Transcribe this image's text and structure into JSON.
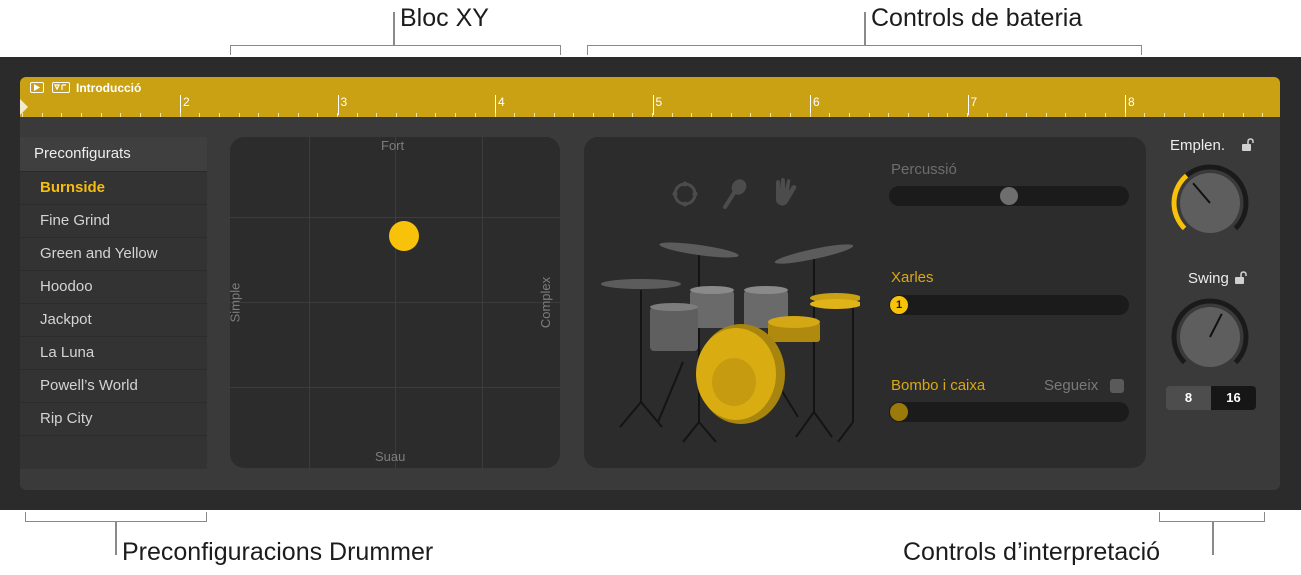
{
  "callouts": {
    "xy_pad": "Bloc XY",
    "drum_controls": "Controls de bateria",
    "presets": "Preconfiguracions Drummer",
    "performance": "Controls d’interpretació"
  },
  "region": {
    "name": "Introducció",
    "bar_numbers": [
      "2",
      "3",
      "4",
      "5",
      "6",
      "7",
      "8"
    ]
  },
  "presets": {
    "header": "Preconfigurats",
    "items": [
      {
        "label": "Burnside",
        "selected": true
      },
      {
        "label": "Fine Grind",
        "selected": false
      },
      {
        "label": "Green and Yellow",
        "selected": false
      },
      {
        "label": "Hoodoo",
        "selected": false
      },
      {
        "label": "Jackpot",
        "selected": false
      },
      {
        "label": "La Luna",
        "selected": false
      },
      {
        "label": "Powell’s World",
        "selected": false
      },
      {
        "label": "Rip City",
        "selected": false
      }
    ]
  },
  "xy_pad": {
    "top": "Fort",
    "bottom": "Suau",
    "left": "Simple",
    "right": "Complex"
  },
  "drum_controls": {
    "percussion_label": "Percussió",
    "percussion_level": 0.5,
    "hihat_label": "Xarles",
    "hihat_value": "1",
    "kick_snare_label": "Bombo i caixa",
    "follow_label": "Segueix",
    "kick_snare_level": 0.0
  },
  "performance": {
    "fill_label": "Emplen.",
    "fill_level": 0.35,
    "swing_label": "Swing",
    "swing_level": 0.6,
    "note_options": [
      "8",
      "16"
    ],
    "note_selected": "16"
  },
  "colors": {
    "accent": "#f8c20a",
    "region": "#c9a112",
    "panel": "#2c2c2c"
  },
  "icons": [
    "play-icon",
    "region-loop-icon",
    "tambourine-icon",
    "shaker-icon",
    "hand-clap-icon",
    "lock-icon",
    "drum-kit-icon"
  ]
}
